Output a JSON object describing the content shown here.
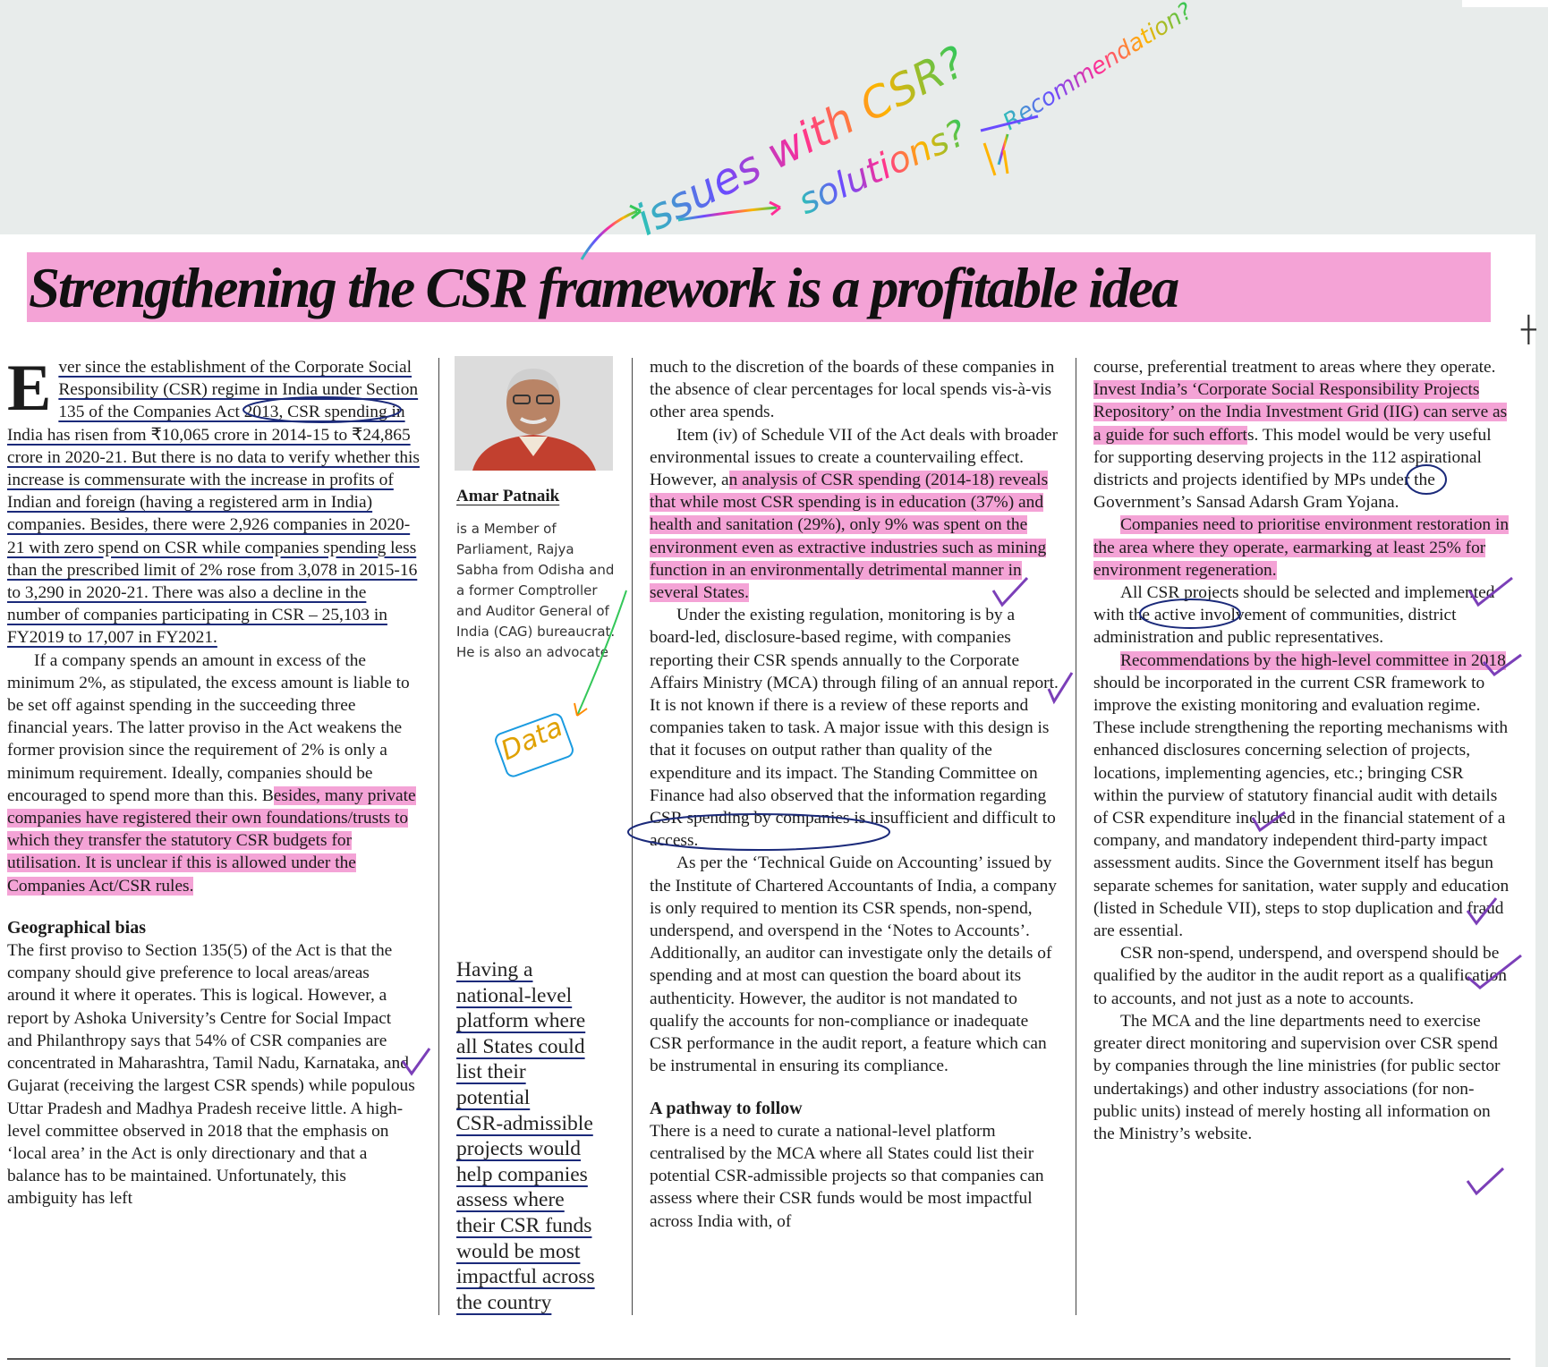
{
  "headline": "Strengthening the CSR framework is a profitable idea",
  "author": {
    "name": "Amar Patnaik",
    "bio": "is a Member of Parliament, Rajya Sabha from Odisha and a former Comptroller and Auditor General of India (CAG) bureaucrat. He is also an advocate"
  },
  "pullquote": {
    "lines": [
      "Having a",
      "national-level",
      "platform where",
      "all States could",
      "list their",
      "potential",
      "CSR-admissible",
      "projects would",
      "help companies",
      "assess where",
      "their CSR funds",
      "would be most",
      "impactful across",
      "the country"
    ]
  },
  "annotations": {
    "issues": "issues with CSR?",
    "solutions": "solutions?",
    "recommendation": "Recommendation?",
    "data": "Data"
  },
  "colors": {
    "highlight": "#f4a3d6",
    "ink_blue": "#1b2a7a",
    "ink_violet": "#7b3fb8"
  },
  "article": {
    "p1_dropcap": "E",
    "p1_a": "ver since the establishment of the Corporate Social Responsibility (CSR) regime in India under Section 135 of the Companies Act 2013, CSR spending in India has risen from ₹10,065 crore in 2014-15 to ₹24,865 crore in 2020-21. But there is no data to verify whether this increase is commensurate with the increase in profits of Indian and foreign (having a registered arm in India) companies. Besides, there were 2,926 companies in 2020-21 with zero spend on CSR while companies spending less than the prescribed limit of 2% rose from 3,078 in 2015-16 to 3,290 in 2020-21. There was also a decline in the number of companies participating in CSR – 25,103 in FY2019 to 17,007 in FY2021.",
    "p2_a": "If a company spends an amount in excess of the minimum 2%, as stipulated, the excess amount is liable to be set off against spending in the succeeding three financial years. The latter proviso in the Act weakens the former provision since the requirement of 2% is only a minimum requirement. Ideally, companies should be encouraged to spend more than this. B",
    "p2_hl": "esides, many private companies have registered their own foundations/trusts to which they transfer the statutory CSR budgets for utilisation. It is unclear if this is allowed under the Companies Act/CSR rules.",
    "sub1": "Geographical bias",
    "p3": "The first proviso to Section 135(5) of the Act is that the company should give preference to local areas/areas around it where it operates. This is logical. However, a report by Ashoka University’s Centre for Social Impact and Philanthropy says that 54% of CSR companies are concentrated in Maharashtra, Tamil Nadu, Karnataka, and Gujarat (receiving the largest CSR spends) while populous Uttar Pradesh and Madhya Pradesh receive little. A high-level committee observed in 2018 that the emphasis on ‘local area’ in the Act is only directionary and that a balance has to be maintained. Unfortunately, this ambiguity has left",
    "p4": "much to the discretion of the boards of these companies in the absence of clear percentages for local spends vis-à-vis other area spends.",
    "p5_a": "Item (iv) of Schedule VII of the Act deals with broader environmental issues to create a countervailing effect. However, a",
    "p5_hl": "n analysis of CSR spending (2014-18) reveals that while most CSR spending is in education (37%) and health and sanitation (29%), only 9% was spent on the environment even as extractive industries such as mining function in an environmentally detrimental manner in several States.",
    "p6": "Under the existing regulation, monitoring is by a board-led, disclosure-based regime, with companies reporting their CSR spends annually to the Corporate Affairs Ministry (MCA) through filing of an annual report. It is not known if there is a review of these reports and companies taken to task. A major issue with this design is that it focuses on output rather than quality of the expenditure and its impact. The Standing Committee on Finance had also observed that the information regarding CSR spending by companies is insufficient and difficult to access.",
    "p7": "As per the ‘Technical Guide on Accounting’ issued by the Institute of Chartered Accountants of India, a company is only required to mention its CSR spends, non-spend, underspend, and overspend in the ‘Notes to Accounts’. Additionally, an auditor can investigate only the details of spending and at most can question the board about its authenticity. However, the auditor is not mandated to qualify the accounts for non-compliance or inadequate CSR performance in the audit report, a feature which can be instrumental in ensuring its compliance.",
    "sub2": "A pathway to follow",
    "p8": "There is a need to curate a national-level platform centralised by the MCA where all States could list their potential CSR-admissible projects so that companies can assess where their CSR funds would be most impactful across India with, of",
    "p9_a": "course, preferential treatment to areas where they operate. ",
    "p9_hl": "Invest India’s ‘Corporate Social Responsibility Projects Repository’ on the India Investment Grid (IIG) can serve as a guide for such effort",
    "p9_b": "s. This model would be very useful for supporting deserving projects in the 112 aspirational districts and projects identified by MPs under the Government’s Sansad Adarsh Gram Yojana.",
    "p10_hl": "Companies need to prioritise environment restoration in the area where they operate, earmarking at least 25% for environment regeneration.",
    "p11": "All CSR projects should be selected and implemented with the active involvement of communities, district administration and public representatives.",
    "p12_hl": "Recommendations by the high-level committee in 2018",
    "p12_b": " should be incorporated in the current CSR framework to improve the existing monitoring and evaluation regime. These include strengthening the reporting mechanisms with enhanced disclosures concerning selection of projects, locations, implementing agencies, etc.; bringing CSR within the purview of statutory financial audit with details of CSR expenditure included in the financial statement of a company, and mandatory independent third-party impact assessment audits. Since the Government itself has begun separate schemes for sanitation, water supply and education (listed in Schedule VII), steps to stop duplication and fraud are essential.",
    "p13": "CSR non-spend, underspend, and overspend should be qualified by the auditor in the audit report as a qualification to accounts, and not just as a note to accounts.",
    "p14": "The MCA and the line departments need to exercise greater direct monitoring and supervision over CSR spend by companies through the line ministries (for public sector undertakings) and other industry associations (for non-public units) instead of merely hosting all information on the Ministry’s website."
  }
}
